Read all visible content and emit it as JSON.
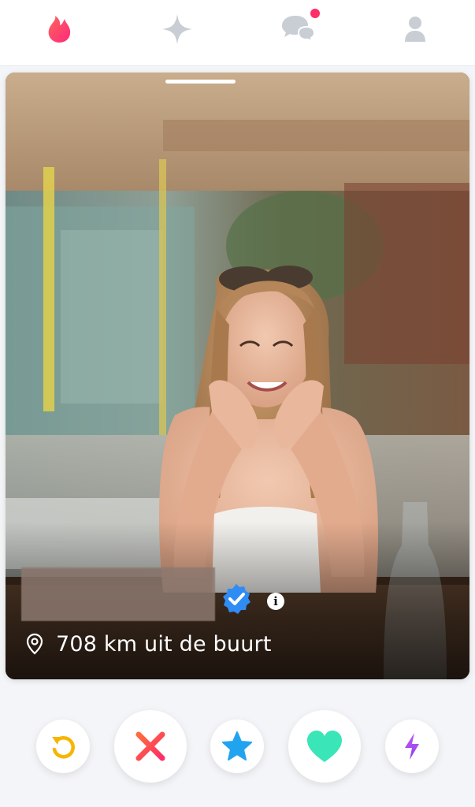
{
  "nav": {
    "items": [
      {
        "name": "home",
        "icon": "flame-icon",
        "active": true
      },
      {
        "name": "explore",
        "icon": "sparkle-icon",
        "active": false
      },
      {
        "name": "messages",
        "icon": "chat-bubbles-icon",
        "active": false,
        "has_notification": true
      },
      {
        "name": "profile",
        "icon": "person-icon",
        "active": false
      }
    ]
  },
  "card": {
    "name": "",
    "verified": true,
    "distance": "708 km uit de buurt",
    "photo_count_indicator": 1,
    "location_icon": "location-pin-icon",
    "info_icon": "info-icon",
    "info_label": "i"
  },
  "actions": [
    {
      "name": "rewind",
      "icon": "rewind-icon",
      "color": "#f7b500"
    },
    {
      "name": "nope",
      "icon": "x-icon",
      "color": "#fd4f5f"
    },
    {
      "name": "super-like",
      "icon": "star-icon",
      "color": "#21a4f0"
    },
    {
      "name": "like",
      "icon": "heart-icon",
      "color": "#3ae6b8"
    },
    {
      "name": "boost",
      "icon": "bolt-icon",
      "color": "#a943f5"
    }
  ],
  "colors": {
    "brand": "#fd2e68",
    "inactive_icon": "#c9cdd4",
    "notification": "#fd2e68"
  }
}
